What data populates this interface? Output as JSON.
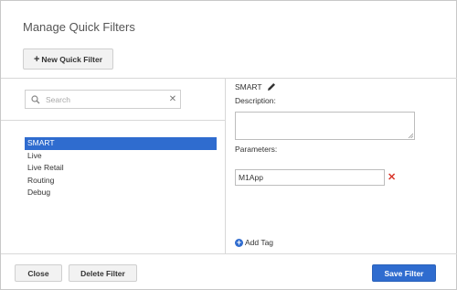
{
  "dialog": {
    "title": "Manage Quick Filters",
    "new_button_label": "New Quick Filter"
  },
  "search": {
    "placeholder": "Search",
    "value": ""
  },
  "filters": {
    "items": [
      {
        "label": "SMART",
        "selected": true
      },
      {
        "label": "Live",
        "selected": false
      },
      {
        "label": "Live Retail",
        "selected": false
      },
      {
        "label": "Routing",
        "selected": false
      },
      {
        "label": "Debug",
        "selected": false
      }
    ]
  },
  "detail": {
    "name": "SMART",
    "description_label": "Description:",
    "description_value": "",
    "parameters_label": "Parameters:",
    "parameter_value": "M1App",
    "add_tag_label": "Add Tag"
  },
  "footer": {
    "close_label": "Close",
    "delete_label": "Delete Filter",
    "save_label": "Save Filter"
  },
  "colors": {
    "accent": "#2f6ccf",
    "remove": "#d9362b"
  },
  "icons": {
    "search": "search-icon",
    "clear": "clear-icon",
    "edit": "pencil-icon",
    "remove": "remove-icon",
    "add": "add-circle-icon"
  }
}
